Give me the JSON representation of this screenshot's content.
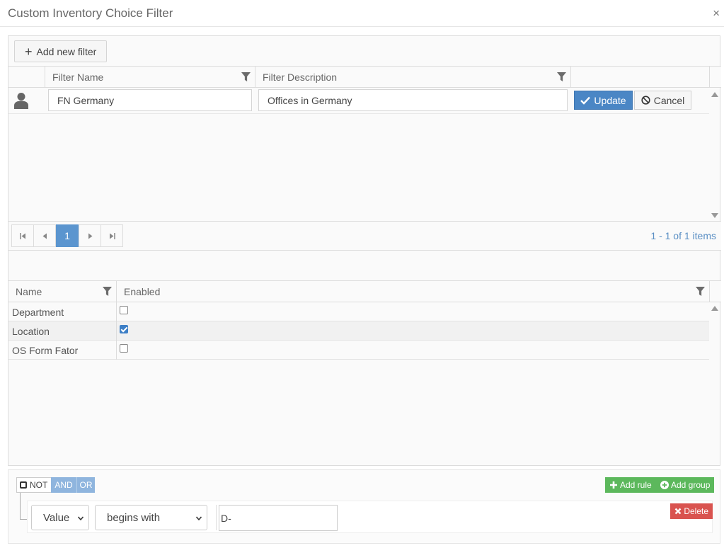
{
  "window": {
    "title": "Custom Inventory Choice Filter",
    "close_glyph": "×"
  },
  "toolbar": {
    "add_label": "Add new filter",
    "add_icon": "plus-icon"
  },
  "filters_grid": {
    "columns": [
      "Filter Name",
      "Filter Description"
    ],
    "edit_row": {
      "name_value": "FN Germany",
      "description_value": "Offices in Germany",
      "update_label": "Update",
      "cancel_label": "Cancel"
    },
    "pager": {
      "current_page": "1",
      "info": "1 - 1 of 1 items"
    }
  },
  "fields_grid": {
    "columns": [
      "Name",
      "Enabled"
    ],
    "rows": [
      {
        "name": "Department",
        "enabled": false
      },
      {
        "name": "Location",
        "enabled": true
      },
      {
        "name": "OS Form Fator",
        "enabled": false
      }
    ]
  },
  "query_builder": {
    "not_label": "NOT",
    "and_label": "AND",
    "or_label": "OR",
    "add_rule_label": "Add rule",
    "add_group_label": "Add group",
    "delete_label": "Delete",
    "rule": {
      "field": "Value",
      "operator": "begins with",
      "value": "D-"
    }
  },
  "colors": {
    "primary": "#4a86c5",
    "success": "#5cb85c",
    "danger": "#d9534f",
    "group_toggle": "#8fb5de"
  }
}
